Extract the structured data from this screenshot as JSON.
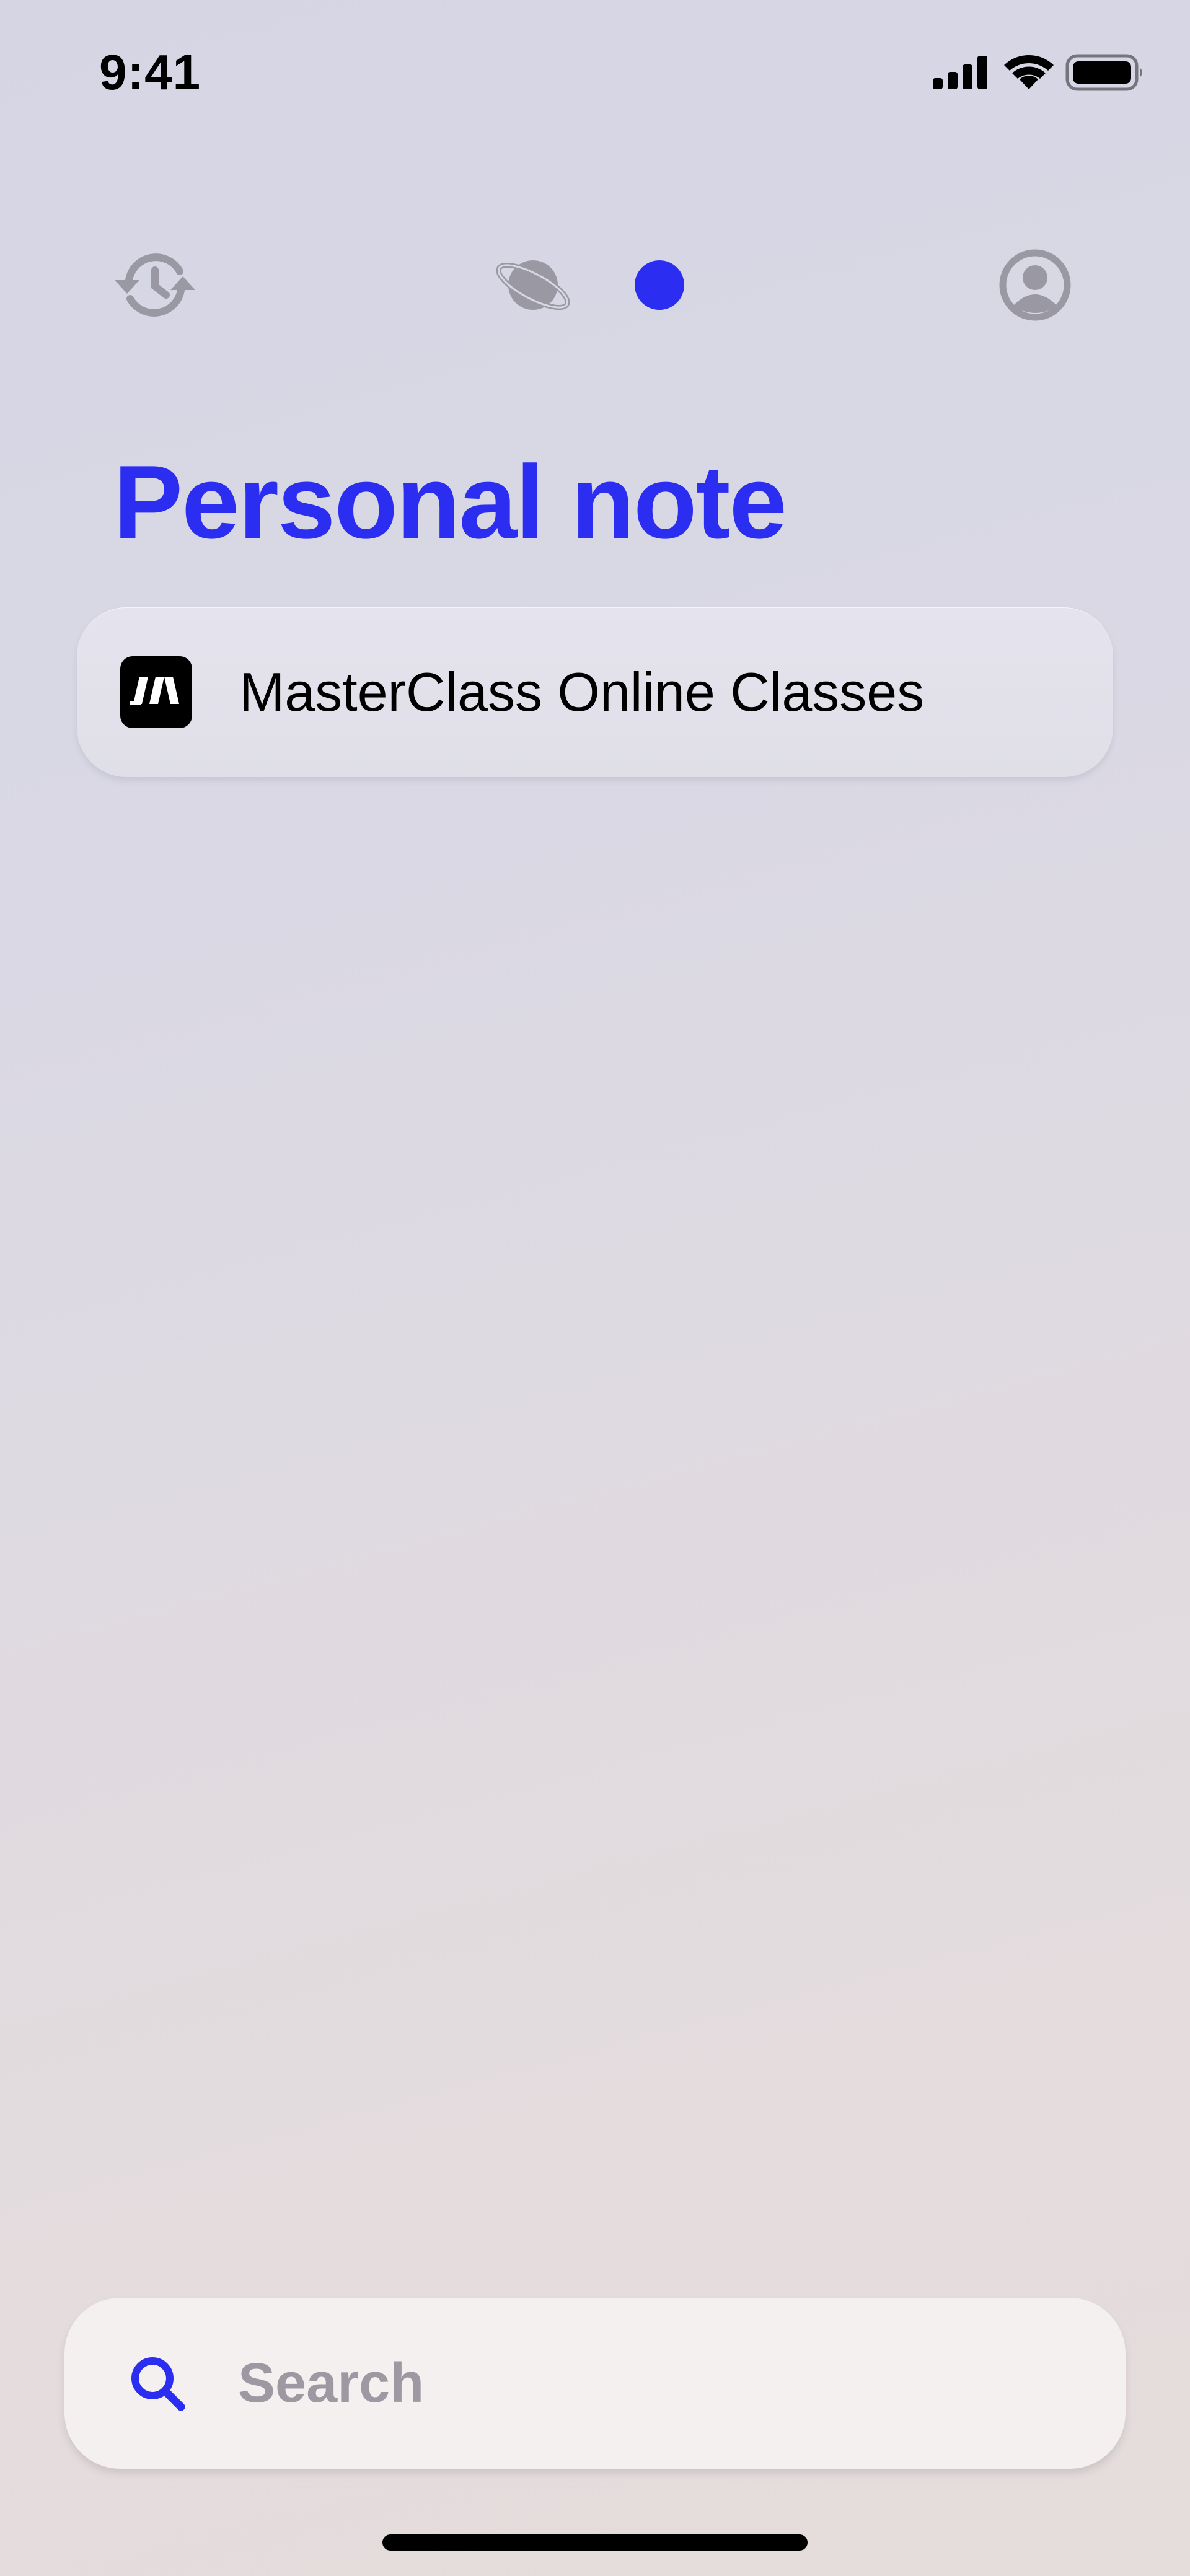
{
  "status_bar": {
    "time": "9:41"
  },
  "nav": {
    "icons": [
      "history-icon",
      "planet-icon",
      "active-dot",
      "profile-icon"
    ]
  },
  "title": "Personal note",
  "list": [
    {
      "label": "MasterClass Online Classes",
      "icon": "masterclass-logo"
    }
  ],
  "search": {
    "placeholder": "Search",
    "value": ""
  },
  "colors": {
    "accent": "#2b2df0",
    "icon_gray": "#9a99a3",
    "text": "#000000"
  }
}
